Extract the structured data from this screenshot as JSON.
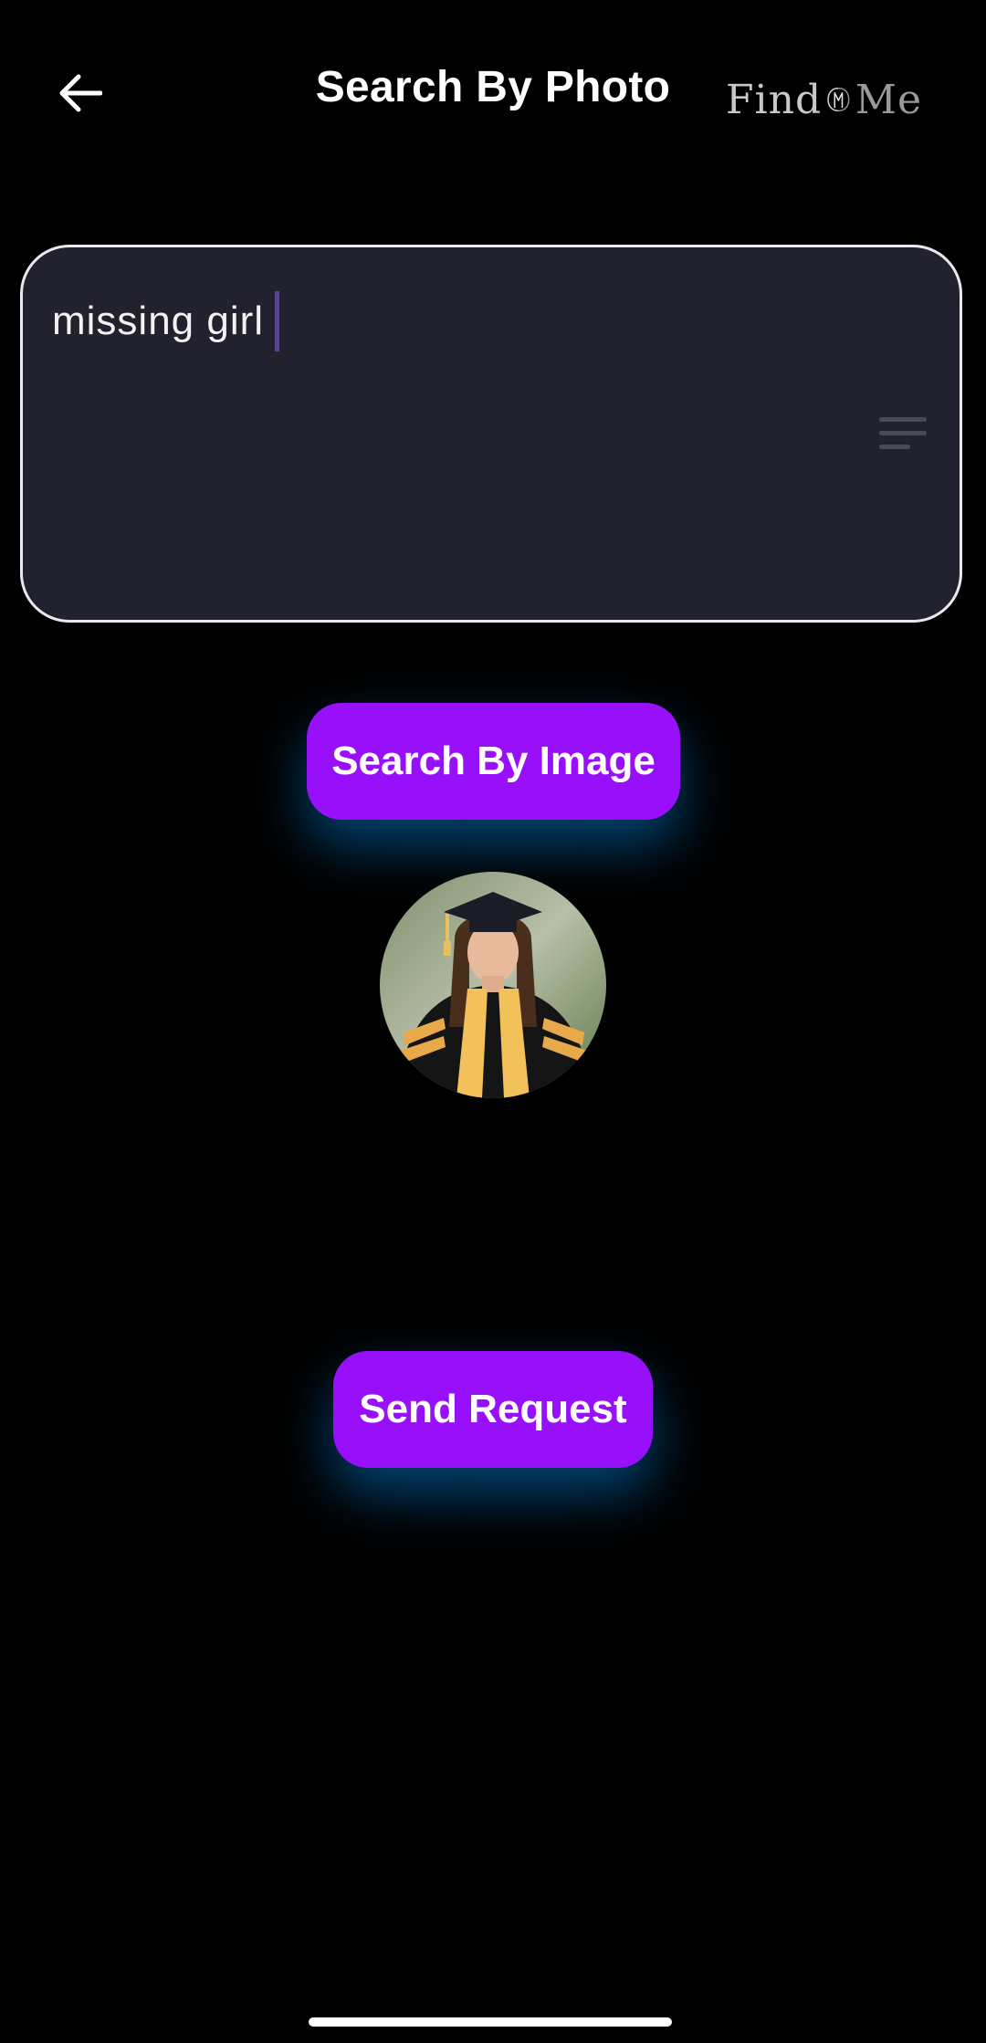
{
  "header": {
    "title": "Search By Photo",
    "back_icon": "arrow-left-icon",
    "logo": {
      "left": "Find",
      "right": "Me"
    }
  },
  "search": {
    "value": "missing girl",
    "field_icon": "lines-icon"
  },
  "buttons": {
    "search_by_image": "Search By Image",
    "send_request": "Send Request"
  },
  "photo": {
    "icon": "selected-photo-thumbnail"
  },
  "colors": {
    "background": "#000000",
    "accent": "#9810fa",
    "glow": "#0096ff",
    "field_bg": "#22222e",
    "field_border": "#e8e8f0"
  }
}
